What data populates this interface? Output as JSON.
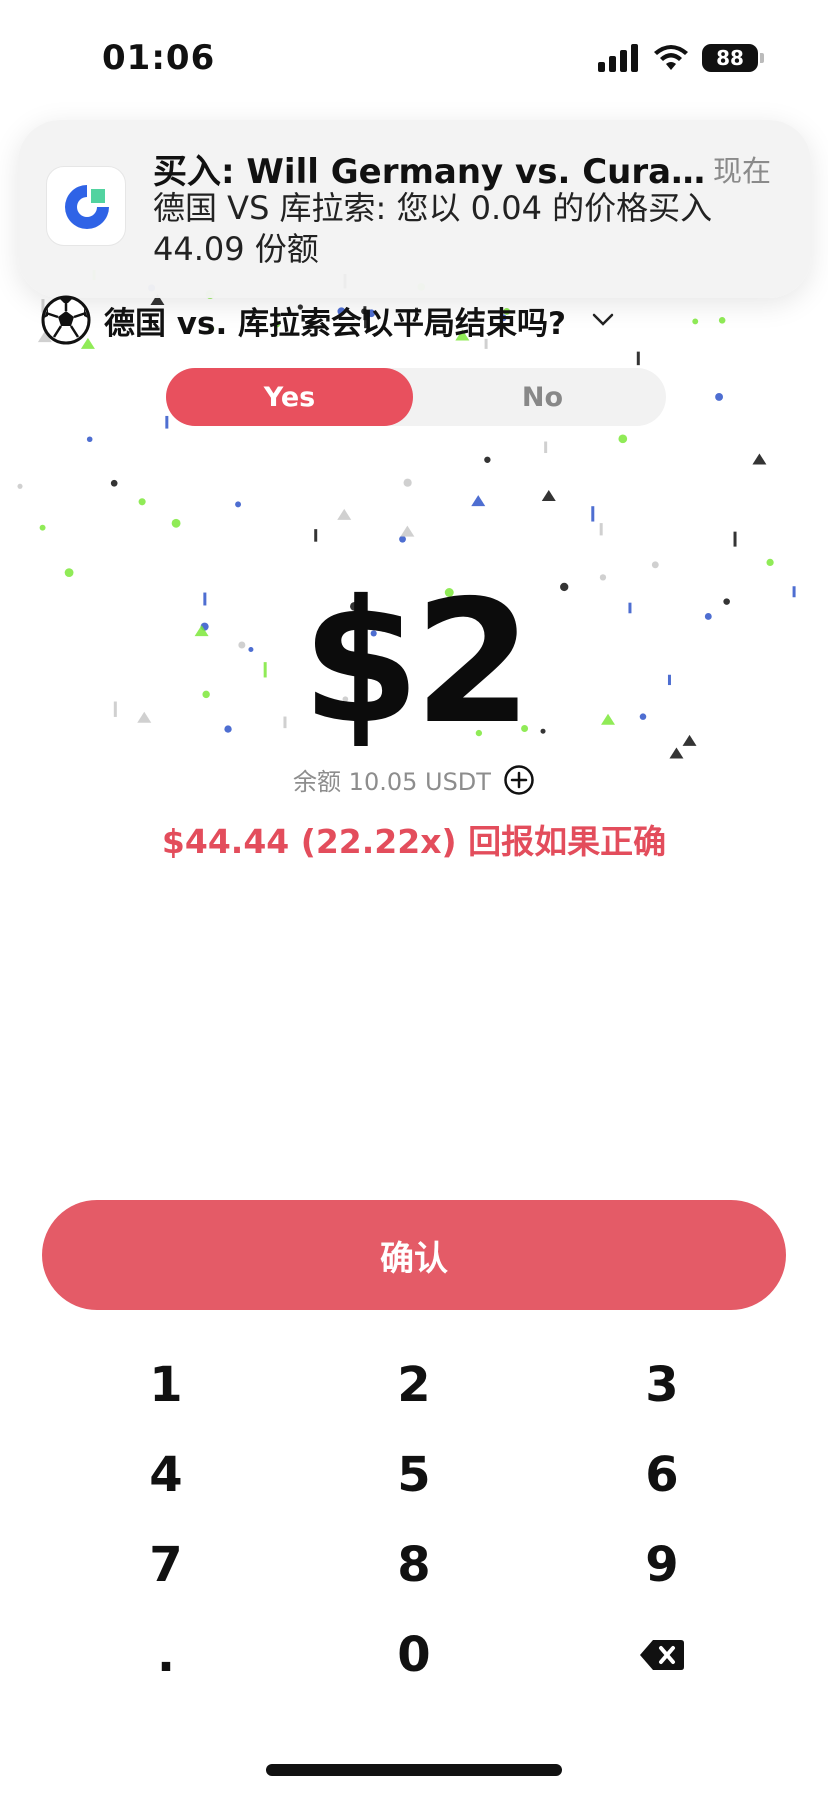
{
  "status_bar": {
    "time": "01:06",
    "battery": "88"
  },
  "notification": {
    "title": "买入: Will Germany vs. Curaça...",
    "time": "现在",
    "body": "德国 VS 库拉索: 您以 0.04 的价格买入 44.09 份额"
  },
  "market": {
    "title": "德国 vs. 库拉索会以平局结束吗?"
  },
  "toggle": {
    "yes": "Yes",
    "no": "No",
    "selected": "Yes"
  },
  "amount": "$2",
  "balance": {
    "label": "余额 10.05 USDT"
  },
  "payout": "$44.44 (22.22x) 回报如果正确",
  "confirm_label": "确认",
  "keypad": {
    "k1": "1",
    "k2": "2",
    "k3": "3",
    "k4": "4",
    "k5": "5",
    "k6": "6",
    "k7": "7",
    "k8": "8",
    "k9": "9",
    "kdot": ".",
    "k0": "0"
  },
  "colors": {
    "accent": "#e8505e",
    "confirm": "#e45b67",
    "payout": "#e34d5c"
  },
  "icons": [
    "signal-icon",
    "wifi-icon",
    "app-logo-icon",
    "soccer-ball-icon",
    "chevron-down-icon",
    "add-circle-icon",
    "backspace-icon"
  ]
}
